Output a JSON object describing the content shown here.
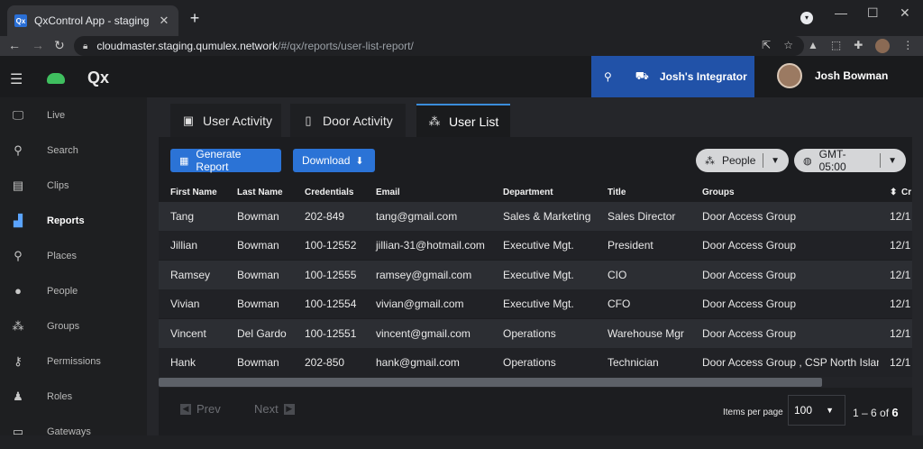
{
  "browser": {
    "tab_title": "QxControl App - staging",
    "favicon_text": "Qx",
    "url_host": "cloudmaster.staging.qumulex.network",
    "url_path": "/#/qx/reports/user-list-report/"
  },
  "app": {
    "brand": "Qx",
    "integrator_name": "Josh's Integrator",
    "user_name": "Josh Bowman"
  },
  "sidebar": {
    "items": [
      {
        "label": "Live",
        "icon": "monitor-icon"
      },
      {
        "label": "Search",
        "icon": "search-icon"
      },
      {
        "label": "Clips",
        "icon": "file-icon"
      },
      {
        "label": "Reports",
        "icon": "chart-icon"
      },
      {
        "label": "Places",
        "icon": "map-pin-icon"
      },
      {
        "label": "People",
        "icon": "person-icon"
      },
      {
        "label": "Groups",
        "icon": "group-icon"
      },
      {
        "label": "Permissions",
        "icon": "key-icon"
      },
      {
        "label": "Roles",
        "icon": "role-icon"
      },
      {
        "label": "Gateways",
        "icon": "gateway-icon"
      }
    ],
    "active": "Reports"
  },
  "report_tabs": [
    {
      "label": "User Activity",
      "icon": "id-badge-icon"
    },
    {
      "label": "Door Activity",
      "icon": "door-icon"
    },
    {
      "label": "User List",
      "icon": "users-icon"
    }
  ],
  "toolbar": {
    "generate_label": "Generate Report",
    "download_label": "Download",
    "people_label": "People",
    "timezone_label": "GMT-05:00"
  },
  "table": {
    "columns": [
      "First Name",
      "Last Name",
      "Credentials",
      "Email",
      "Department",
      "Title",
      "Groups",
      "Cr"
    ],
    "rows": [
      [
        "Tang",
        "Bowman",
        "202-849",
        "tang@gmail.com",
        "Sales & Marketing",
        "Sales Director",
        "Door Access Group",
        "12/1"
      ],
      [
        "Jillian",
        "Bowman",
        "100-12552",
        "jillian-31@hotmail.com",
        "Executive Mgt.",
        "President",
        "Door Access Group",
        "12/1"
      ],
      [
        "Ramsey",
        "Bowman",
        "100-12555",
        "ramsey@gmail.com",
        "Executive Mgt.",
        "CIO",
        "Door Access Group",
        "12/1"
      ],
      [
        "Vivian",
        "Bowman",
        "100-12554",
        "vivian@gmail.com",
        "Executive Mgt.",
        "CFO",
        "Door Access Group",
        "12/1"
      ],
      [
        "Vincent",
        "Del Gardo",
        "100-12551",
        "vincent@gmail.com",
        "Operations",
        "Warehouse Mgr",
        "Door Access Group",
        "12/1"
      ],
      [
        "Hank",
        "Bowman",
        "202-850",
        "hank@gmail.com",
        "Operations",
        "Technician",
        "Door Access Group , CSP North Islan...",
        "12/1"
      ]
    ]
  },
  "pager": {
    "prev_label": "Prev",
    "next_label": "Next",
    "items_per_page_label": "Items per page",
    "items_per_page_value": "100",
    "range_text": "1 – 6 of",
    "total": "6"
  }
}
